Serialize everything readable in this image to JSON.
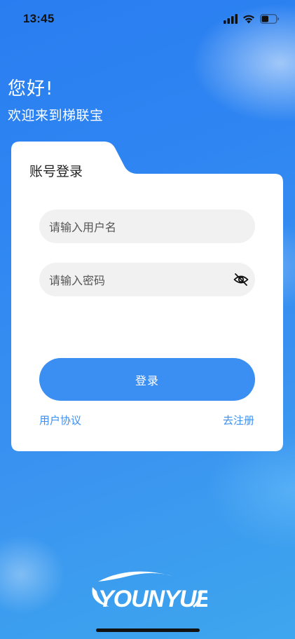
{
  "status_bar": {
    "time": "13:45",
    "icons": [
      "cellular-signal-icon",
      "wifi-icon",
      "battery-icon"
    ]
  },
  "greeting": {
    "title": "您好!",
    "subtitle": "欢迎来到梯联宝"
  },
  "login_card": {
    "tab_label": "账号登录",
    "username": {
      "value": "",
      "placeholder": "请输入用户名"
    },
    "password": {
      "value": "",
      "placeholder": "请输入密码"
    },
    "password_toggle_icon": "eye-off-icon",
    "login_button_label": "登录",
    "agreement_link": "用户协议",
    "register_link": "去注册"
  },
  "brand": {
    "logo_text": "YOUNYUE",
    "logo_icon": "younyue-logo"
  },
  "colors": {
    "accent": "#3b8ff2",
    "background_top": "#2a7df0",
    "background_bottom": "#3ea6ee",
    "input_background": "#f2f1f1"
  }
}
